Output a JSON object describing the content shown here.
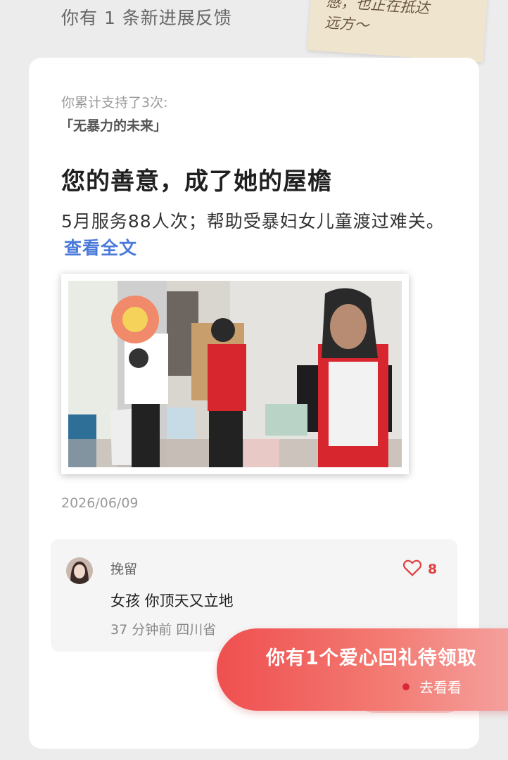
{
  "header": {
    "title": "你有 1 条新进展反馈"
  },
  "note": {
    "text": "感，也正在抵达\n远方～"
  },
  "card": {
    "support_count": "你累计支持了3次:",
    "project_name": "「无暴力的未来」",
    "headline": "您的善意，成了她的屋檐",
    "summary": "5月服务88人次；帮助受暴妇女儿童渡过难关。",
    "read_more": "查看全文",
    "date": "2026/06/09"
  },
  "comment": {
    "username": "挽留",
    "likes": "8",
    "text": "女孩 你顶天又立地",
    "meta": "37 分钟前 四川省"
  },
  "gift_banner": {
    "title": "你有1个爱心回礼待领取",
    "link": "去看看"
  },
  "colors": {
    "accent_red": "#ef4f4f",
    "link_blue": "#4a79d9",
    "like_red": "#e04040"
  },
  "icons": {
    "like": "heart-outline-icon"
  }
}
